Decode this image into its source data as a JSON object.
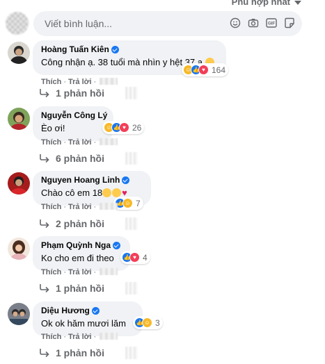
{
  "sort": {
    "label": "Phù hợp nhất"
  },
  "composer": {
    "placeholder": "Viết bình luận..."
  },
  "comments": [
    {
      "name": "Hoàng Tuấn Kiên",
      "text": "Công nhận ạ. 38 tuổi mà nhìn y hệt 37 ạ",
      "reaction_count": "164",
      "reactions": [
        "haha",
        "like",
        "love"
      ],
      "like_label": "Thích",
      "reply_label": "Trả lời",
      "replies_label": "1 phản hồi"
    },
    {
      "name": "Nguyễn Công Lý",
      "text": "Èo ơi!",
      "reaction_count": "26",
      "reactions": [
        "haha",
        "like",
        "love"
      ],
      "like_label": "Thích",
      "reply_label": "Trả lời",
      "replies_label": "6 phản hồi"
    },
    {
      "name": "Nguyen Hoang Linh",
      "text": "Chào cô em 18",
      "reaction_count": "7",
      "reactions": [
        "like",
        "haha"
      ],
      "like_label": "Thích",
      "reply_label": "Trả lời",
      "replies_label": "2 phản hồi"
    },
    {
      "name": "Phạm Quỳnh Nga",
      "text": "Ko cho em đi theo",
      "reaction_count": "4",
      "reactions": [
        "like",
        "love"
      ],
      "like_label": "Thích",
      "reply_label": "Trả lời",
      "replies_label": "1 phản hồi"
    },
    {
      "name": "Diệu Hương",
      "text": "Ok ok hăm mươi lăm",
      "reaction_count": "3",
      "reactions": [
        "like",
        "haha"
      ],
      "like_label": "Thích",
      "reply_label": "Trả lời",
      "replies_label": "1 phản hồi"
    }
  ],
  "colors": {
    "bubble": "#f0f2f5",
    "secondary_text": "#65676b",
    "verified": "#1877f2",
    "haha": "#f7b928",
    "like": "#1877f2",
    "love": "#f33e58"
  },
  "icons": [
    "smiley-icon",
    "camera-icon",
    "gif-icon",
    "sticker-icon",
    "verified-badge-icon",
    "reply-arrow-icon"
  ]
}
